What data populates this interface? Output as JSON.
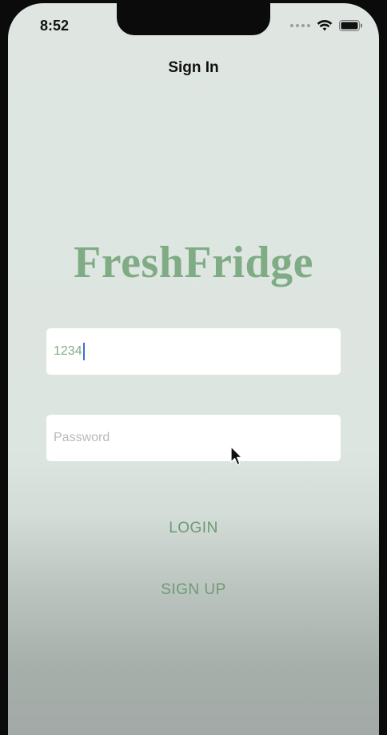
{
  "status_bar": {
    "time": "8:52",
    "icons": [
      "signal-icon",
      "wifi-icon",
      "battery-icon"
    ]
  },
  "nav": {
    "title": "Sign In"
  },
  "app": {
    "title": "FreshFridge"
  },
  "form": {
    "username_value": "1234",
    "password_placeholder": "Password"
  },
  "buttons": {
    "login_label": "LOGIN",
    "signup_label": "SIGN UP"
  },
  "colors": {
    "accent": "#7fac85",
    "background": "#dfe6e2",
    "caret": "#3d6fd6"
  }
}
